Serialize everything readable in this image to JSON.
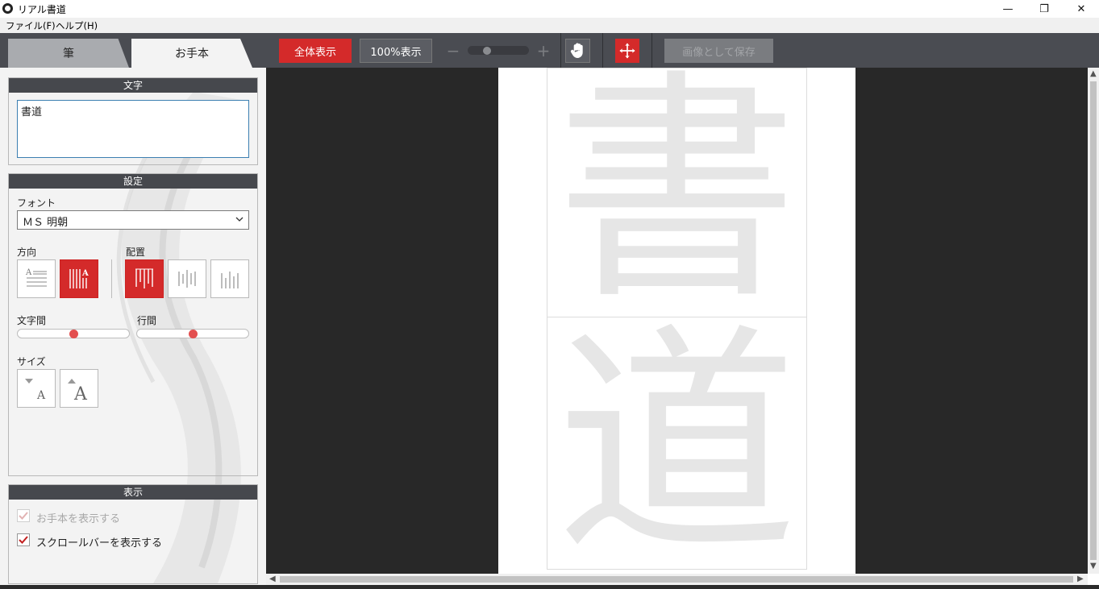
{
  "window": {
    "title": "リアル書道",
    "minimize": "—",
    "restore": "❐",
    "close": "✕"
  },
  "menu": [
    "ファイル(F)",
    "ヘルプ(H)"
  ],
  "tabs": [
    {
      "label": "筆",
      "active": false
    },
    {
      "label": "お手本",
      "active": true
    }
  ],
  "toolbar": {
    "fit_label": "全体表示",
    "hundred_label": "100%表示",
    "zoom_minus": "−",
    "zoom_plus": "+",
    "save_label": "画像として保存",
    "zoom_level_fraction": 0.25
  },
  "text_section": {
    "header": "文字",
    "value": "書道"
  },
  "settings_section": {
    "header": "設定",
    "font_label": "フォント",
    "font_value": "ＭＳ 明朝",
    "direction_label": "方向",
    "layout_label": "配置",
    "char_spacing_label": "文字間",
    "line_spacing_label": "行間",
    "char_spacing_value": 0.5,
    "line_spacing_value": 0.5,
    "size_label": "サイズ"
  },
  "display_section": {
    "header": "表示",
    "show_model_label": "お手本を表示する",
    "show_model_checked": true,
    "show_model_disabled": true,
    "show_scrollbar_label": "スクロールバーを表示する",
    "show_scrollbar_checked": true
  },
  "canvas": {
    "chars": [
      "書",
      "道"
    ]
  },
  "colors": {
    "accent": "#d42a2a",
    "band": "#4a4c52",
    "canvas_bg": "#282828"
  }
}
